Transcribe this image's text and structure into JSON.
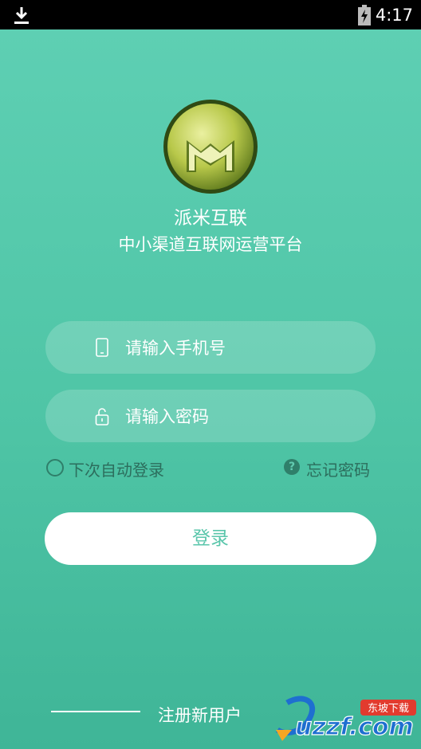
{
  "status_bar": {
    "time": "4:17",
    "download_icon": "download-icon",
    "battery_icon": "battery-charging-icon"
  },
  "app": {
    "name": "派米互联",
    "subtitle": "中小渠道互联网运营平台",
    "logo_icon": "m-logo-icon"
  },
  "form": {
    "phone": {
      "placeholder": "请输入手机号",
      "value": "",
      "icon": "phone-icon"
    },
    "password": {
      "placeholder": "请输入密码",
      "value": "",
      "icon": "lock-icon"
    },
    "remember_label": "下次自动登录",
    "forgot_label": "忘记密码",
    "login_label": "登录"
  },
  "register_label": "注册新用户",
  "watermark": {
    "badge": "东坡下载",
    "text": "uzzf.com"
  },
  "colors": {
    "background": "#4fc5a6",
    "accent_text": "#5ac6ab",
    "dark_text": "#2c6e5d"
  }
}
